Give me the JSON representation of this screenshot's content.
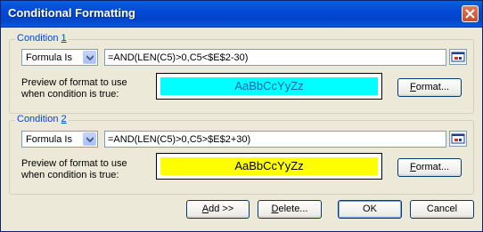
{
  "window": {
    "title": "Conditional Formatting"
  },
  "conditions": [
    {
      "legend_prefix": "Condition ",
      "legend_number": "1",
      "type_value": "Formula Is",
      "formula": "=AND(LEN(C5)>0,C5<$E$2-30)",
      "preview_label_line1": "Preview of format to use",
      "preview_label_line2": "when condition is true:",
      "preview_text": "AaBbCcYyZz",
      "preview_bg": "#00ffff",
      "format_button_rest": "ormat...",
      "format_button_accel": "F"
    },
    {
      "legend_prefix": "Condition ",
      "legend_number": "2",
      "type_value": "Formula Is",
      "formula": "=AND(LEN(C5)>0,C5>$E$2+30)",
      "preview_label_line1": "Preview of format to use",
      "preview_label_line2": "when condition is true:",
      "preview_text": "AaBbCcYyZz",
      "preview_bg": "#ffff00",
      "format_button_rest": "ormat...",
      "format_button_accel": "F"
    }
  ],
  "footer": {
    "add_accel": "A",
    "add_rest": "dd >>",
    "delete_accel": "D",
    "delete_rest": "elete...",
    "ok_label": "OK",
    "cancel_label": "Cancel"
  },
  "icons": {
    "close": "close-icon",
    "dropdown": "chevron-down-icon",
    "collapse": "collapse-dialog-icon"
  },
  "colors": {
    "title_bar": "#0a5fe0",
    "dialog_bg": "#ece9d8",
    "legend_text": "#0046d5"
  }
}
